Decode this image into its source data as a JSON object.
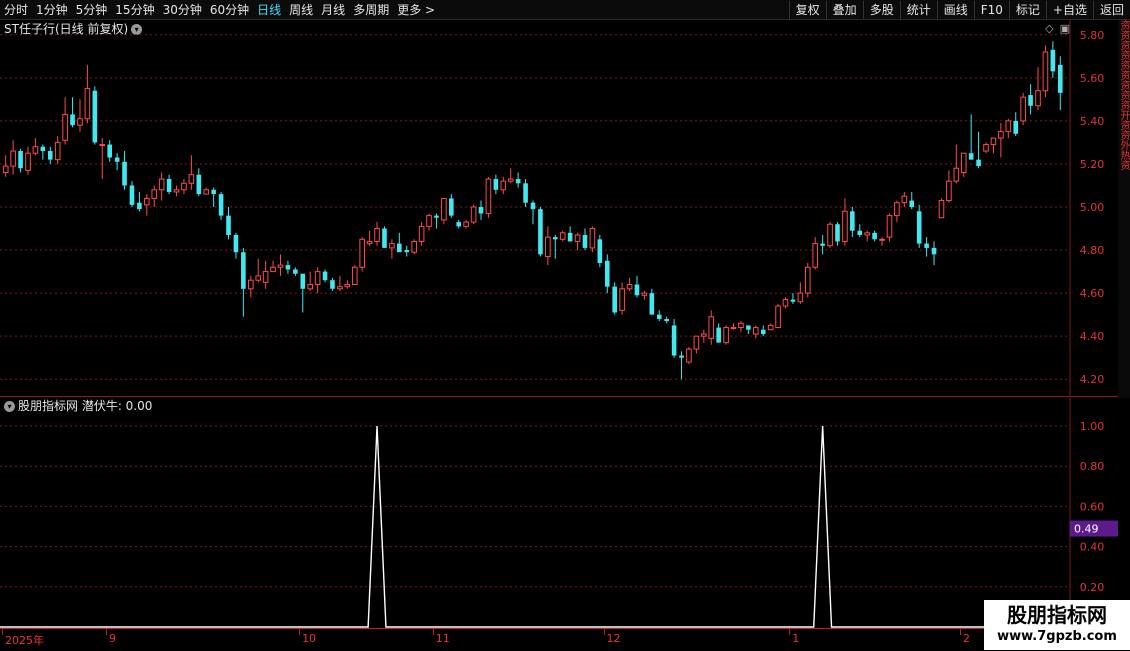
{
  "toolbar": {
    "periods": [
      "分时",
      "1分钟",
      "5分钟",
      "15分钟",
      "30分钟",
      "60分钟",
      "日线",
      "周线",
      "月线",
      "多周期",
      "更多 >"
    ],
    "active_period": "日线",
    "tools": [
      "复权",
      "叠加",
      "多股",
      "统计",
      "画线",
      "F10",
      "标记",
      "+自选",
      "返回"
    ]
  },
  "stock_title": "ST任子行(日线 前复权)",
  "indicator": {
    "title": "股朋指标网 潜伏牛: 0.00",
    "current_value_tag": "0.49"
  },
  "right_strip_text": "资资资资资资资资资开资资外热资",
  "watermark": {
    "line1": "股朋指标网",
    "line2": "www.7gpzb.com"
  },
  "colors": {
    "up": "#ff4a4a",
    "down": "#40e8f0",
    "grid": "#7a1c1c",
    "axis_text": "#e33333",
    "tag_bg": "#5c1a8c"
  },
  "chart_data": [
    {
      "type": "candlestick",
      "title": "ST任子行(日线 前复权)",
      "ylim": [
        4.15,
        5.85
      ],
      "yticks": [
        5.8,
        5.6,
        5.4,
        5.2,
        5.0,
        4.8,
        4.6,
        4.4,
        4.2
      ],
      "candles": [
        [
          5.16,
          5.24,
          5.14,
          5.19
        ],
        [
          5.19,
          5.31,
          5.15,
          5.26
        ],
        [
          5.26,
          5.27,
          5.16,
          5.18
        ],
        [
          5.17,
          5.28,
          5.15,
          5.25
        ],
        [
          5.25,
          5.32,
          5.24,
          5.28
        ],
        [
          5.28,
          5.29,
          5.22,
          5.26
        ],
        [
          5.26,
          5.28,
          5.2,
          5.22
        ],
        [
          5.22,
          5.33,
          5.2,
          5.3
        ],
        [
          5.31,
          5.51,
          5.29,
          5.43
        ],
        [
          5.43,
          5.51,
          5.37,
          5.38
        ],
        [
          5.38,
          5.5,
          5.35,
          5.41
        ],
        [
          5.41,
          5.66,
          5.39,
          5.55
        ],
        [
          5.54,
          5.56,
          5.29,
          5.3
        ],
        [
          5.29,
          5.32,
          5.13,
          5.29
        ],
        [
          5.29,
          5.31,
          5.21,
          5.23
        ],
        [
          5.23,
          5.25,
          5.17,
          5.21
        ],
        [
          5.21,
          5.26,
          5.08,
          5.1
        ],
        [
          5.1,
          5.12,
          5.0,
          5.01
        ],
        [
          5.02,
          5.07,
          4.98,
          4.99
        ],
        [
          5.01,
          5.06,
          4.96,
          5.04
        ],
        [
          5.04,
          5.1,
          5.0,
          5.08
        ],
        [
          5.08,
          5.16,
          5.03,
          5.13
        ],
        [
          5.13,
          5.15,
          5.06,
          5.07
        ],
        [
          5.07,
          5.1,
          5.05,
          5.08
        ],
        [
          5.08,
          5.13,
          5.06,
          5.11
        ],
        [
          5.11,
          5.24,
          5.08,
          5.15
        ],
        [
          5.15,
          5.18,
          5.05,
          5.06
        ],
        [
          5.06,
          5.09,
          5.06,
          5.08
        ],
        [
          5.08,
          5.09,
          5.0,
          5.06
        ],
        [
          5.06,
          5.07,
          4.94,
          4.96
        ],
        [
          4.96,
          5.0,
          4.85,
          4.87
        ],
        [
          4.87,
          4.88,
          4.76,
          4.79
        ],
        [
          4.79,
          4.81,
          4.49,
          4.62
        ],
        [
          4.62,
          4.68,
          4.58,
          4.66
        ],
        [
          4.66,
          4.76,
          4.65,
          4.68
        ],
        [
          4.65,
          4.75,
          4.62,
          4.7
        ],
        [
          4.7,
          4.75,
          4.7,
          4.72
        ],
        [
          4.72,
          4.78,
          4.68,
          4.73
        ],
        [
          4.73,
          4.75,
          4.69,
          4.71
        ],
        [
          4.71,
          4.72,
          4.68,
          4.69
        ],
        [
          4.69,
          4.69,
          4.51,
          4.62
        ],
        [
          4.62,
          4.7,
          4.61,
          4.64
        ],
        [
          4.64,
          4.72,
          4.6,
          4.7
        ],
        [
          4.7,
          4.71,
          4.65,
          4.66
        ],
        [
          4.66,
          4.67,
          4.61,
          4.62
        ],
        [
          4.62,
          4.68,
          4.61,
          4.63
        ],
        [
          4.63,
          4.66,
          4.62,
          4.64
        ],
        [
          4.64,
          4.73,
          4.64,
          4.72
        ],
        [
          4.72,
          4.86,
          4.7,
          4.85
        ],
        [
          4.83,
          4.89,
          4.82,
          4.84
        ],
        [
          4.84,
          4.93,
          4.82,
          4.9
        ],
        [
          4.9,
          4.91,
          4.81,
          4.81
        ],
        [
          4.81,
          4.85,
          4.76,
          4.83
        ],
        [
          4.83,
          4.88,
          4.8,
          4.79
        ],
        [
          4.8,
          4.82,
          4.77,
          4.79
        ],
        [
          4.79,
          4.85,
          4.78,
          4.84
        ],
        [
          4.84,
          4.93,
          4.82,
          4.91
        ],
        [
          4.91,
          4.97,
          4.89,
          4.96
        ],
        [
          4.96,
          4.97,
          4.9,
          4.95
        ],
        [
          4.94,
          5.04,
          4.92,
          5.04
        ],
        [
          5.04,
          5.06,
          4.95,
          4.96
        ],
        [
          4.93,
          4.94,
          4.9,
          4.91
        ],
        [
          4.91,
          4.94,
          4.9,
          4.93
        ],
        [
          4.93,
          5.01,
          4.92,
          5.0
        ],
        [
          5.0,
          5.03,
          4.94,
          4.97
        ],
        [
          4.97,
          5.14,
          4.95,
          5.13
        ],
        [
          5.13,
          5.15,
          5.06,
          5.08
        ],
        [
          5.08,
          5.14,
          5.06,
          5.12
        ],
        [
          5.12,
          5.18,
          5.11,
          5.13
        ],
        [
          5.13,
          5.16,
          5.09,
          5.11
        ],
        [
          5.11,
          5.13,
          5.0,
          5.02
        ],
        [
          5.02,
          5.03,
          4.92,
          4.99
        ],
        [
          4.99,
          5.0,
          4.77,
          4.78
        ],
        [
          4.77,
          4.91,
          4.73,
          4.86
        ],
        [
          4.86,
          4.87,
          4.76,
          4.85
        ],
        [
          4.85,
          4.89,
          4.84,
          4.88
        ],
        [
          4.88,
          4.91,
          4.84,
          4.84
        ],
        [
          4.84,
          4.88,
          4.8,
          4.87
        ],
        [
          4.87,
          4.9,
          4.8,
          4.81
        ],
        [
          4.81,
          4.91,
          4.79,
          4.9
        ],
        [
          4.85,
          4.87,
          4.72,
          4.74
        ],
        [
          4.75,
          4.78,
          4.6,
          4.63
        ],
        [
          4.63,
          4.65,
          4.5,
          4.51
        ],
        [
          4.52,
          4.65,
          4.5,
          4.62
        ],
        [
          4.62,
          4.67,
          4.61,
          4.64
        ],
        [
          4.64,
          4.68,
          4.58,
          4.59
        ],
        [
          4.59,
          4.61,
          4.57,
          4.6
        ],
        [
          4.6,
          4.62,
          4.5,
          4.5
        ],
        [
          4.5,
          4.52,
          4.47,
          4.48
        ],
        [
          4.48,
          4.49,
          4.46,
          4.47
        ],
        [
          4.45,
          4.48,
          4.3,
          4.31
        ],
        [
          4.31,
          4.33,
          4.2,
          4.3
        ],
        [
          4.28,
          4.35,
          4.27,
          4.34
        ],
        [
          4.34,
          4.4,
          4.32,
          4.4
        ],
        [
          4.4,
          4.43,
          4.37,
          4.41
        ],
        [
          4.39,
          4.52,
          4.36,
          4.49
        ],
        [
          4.44,
          4.46,
          4.37,
          4.37
        ],
        [
          4.37,
          4.45,
          4.36,
          4.44
        ],
        [
          4.44,
          4.46,
          4.43,
          4.44
        ],
        [
          4.44,
          4.47,
          4.42,
          4.46
        ],
        [
          4.45,
          4.45,
          4.41,
          4.43
        ],
        [
          4.41,
          4.45,
          4.39,
          4.44
        ],
        [
          4.43,
          4.45,
          4.4,
          4.41
        ],
        [
          4.43,
          4.46,
          4.43,
          4.45
        ],
        [
          4.44,
          4.55,
          4.44,
          4.54
        ],
        [
          4.54,
          4.58,
          4.53,
          4.57
        ],
        [
          4.57,
          4.6,
          4.55,
          4.56
        ],
        [
          4.56,
          4.65,
          4.55,
          4.6
        ],
        [
          4.6,
          4.74,
          4.58,
          4.72
        ],
        [
          4.72,
          4.86,
          4.71,
          4.83
        ],
        [
          4.83,
          4.87,
          4.78,
          4.82
        ],
        [
          4.82,
          4.93,
          4.81,
          4.92
        ],
        [
          4.92,
          4.93,
          4.82,
          4.84
        ],
        [
          4.84,
          5.04,
          4.82,
          4.98
        ],
        [
          4.98,
          5.0,
          4.86,
          4.89
        ],
        [
          4.89,
          4.92,
          4.86,
          4.87
        ],
        [
          4.87,
          4.89,
          4.84,
          4.88
        ],
        [
          4.88,
          4.89,
          4.84,
          4.85
        ],
        [
          4.85,
          4.86,
          4.82,
          4.85
        ],
        [
          4.86,
          4.97,
          4.84,
          4.96
        ],
        [
          4.96,
          5.03,
          4.93,
          5.02
        ],
        [
          5.02,
          5.07,
          5.0,
          5.05
        ],
        [
          5.03,
          5.07,
          4.99,
          5.0
        ],
        [
          4.98,
          5.01,
          4.81,
          4.83
        ],
        [
          4.83,
          4.86,
          4.77,
          4.81
        ],
        [
          4.81,
          4.84,
          4.73,
          4.78
        ],
        [
          4.95,
          5.04,
          4.95,
          5.03
        ],
        [
          5.03,
          5.17,
          5.02,
          5.12
        ],
        [
          5.12,
          5.29,
          5.11,
          5.18
        ],
        [
          5.16,
          5.22,
          5.14,
          5.25
        ],
        [
          5.25,
          5.43,
          5.22,
          5.22
        ],
        [
          5.22,
          5.35,
          5.18,
          5.19
        ],
        [
          5.26,
          5.3,
          5.25,
          5.29
        ],
        [
          5.29,
          5.32,
          5.25,
          5.32
        ],
        [
          5.32,
          5.39,
          5.23,
          5.35
        ],
        [
          5.35,
          5.41,
          5.32,
          5.4
        ],
        [
          5.4,
          5.44,
          5.33,
          5.34
        ],
        [
          5.4,
          5.53,
          5.38,
          5.51
        ],
        [
          5.52,
          5.57,
          5.43,
          5.47
        ],
        [
          5.47,
          5.65,
          5.45,
          5.54
        ],
        [
          5.54,
          5.75,
          5.51,
          5.72
        ],
        [
          5.73,
          5.77,
          5.6,
          5.63
        ],
        [
          5.66,
          5.7,
          5.45,
          5.53
        ]
      ]
    },
    {
      "type": "line",
      "title": "潜伏牛",
      "ylim": [
        0,
        1.05
      ],
      "yticks": [
        1.0,
        0.8,
        0.6,
        0.4,
        0.2
      ],
      "series": [
        {
          "name": "潜伏牛",
          "spikes": [
            {
              "index": 50,
              "value": 1.0
            },
            {
              "index": 110,
              "value": 1.0
            }
          ],
          "baseline": 0.0
        }
      ]
    }
  ],
  "xaxis": {
    "labels": [
      {
        "text": "2025年",
        "index": 0
      },
      {
        "text": "9",
        "index": 14
      },
      {
        "text": "10",
        "index": 40
      },
      {
        "text": "11",
        "index": 58
      },
      {
        "text": "12",
        "index": 81
      },
      {
        "text": "1",
        "index": 106
      },
      {
        "text": "2",
        "index": 129
      }
    ]
  }
}
